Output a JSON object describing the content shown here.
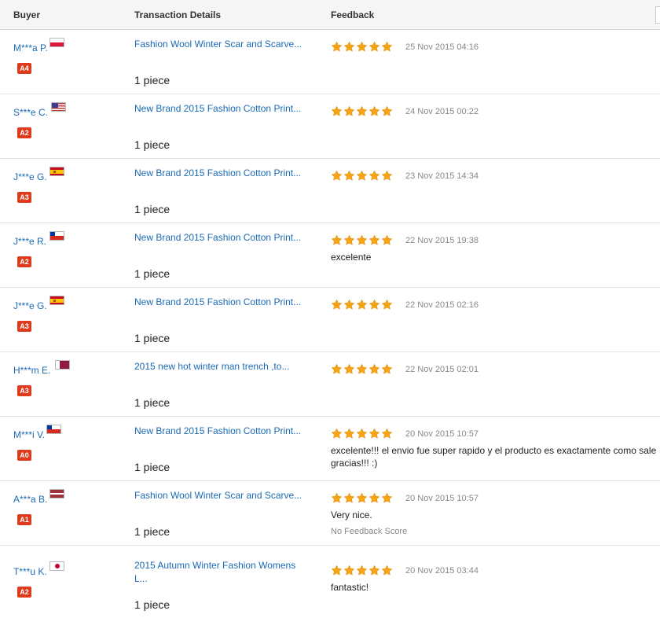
{
  "header": {
    "buyer": "Buyer",
    "transaction": "Transaction Details",
    "feedback": "Feedback"
  },
  "colors": {
    "link": "#1a6ab5",
    "badge": "#dd3b1c",
    "star": "#f7a418"
  },
  "rows": [
    {
      "buyer": "M***a P.",
      "flag": "poland",
      "level": "A4",
      "product": "Fashion Wool Winter Scar and Scarve...",
      "qty": "1 piece",
      "rating": 5,
      "date": "25 Nov 2015 04:16"
    },
    {
      "buyer": "S***e C.",
      "flag": "usa",
      "level": "A2",
      "product": "New Brand 2015 Fashion Cotton Print...",
      "qty": "1 piece",
      "rating": 5,
      "date": "24 Nov 2015 00:22"
    },
    {
      "buyer": "J***e G.",
      "flag": "spain",
      "level": "A3",
      "product": "New Brand 2015 Fashion Cotton Print...",
      "qty": "1 piece",
      "rating": 5,
      "date": "23 Nov 2015 14:34"
    },
    {
      "buyer": "J***e R.",
      "flag": "chile",
      "level": "A2",
      "product": "New Brand 2015 Fashion Cotton Print...",
      "qty": "1 piece",
      "rating": 5,
      "date": "22 Nov 2015 19:38",
      "comment": "excelente"
    },
    {
      "buyer": "J***e G.",
      "flag": "spain",
      "level": "A3",
      "product": "New Brand 2015 Fashion Cotton Print...",
      "qty": "1 piece",
      "rating": 5,
      "date": "22 Nov 2015 02:16"
    },
    {
      "buyer": "H***m E.",
      "flag": "qatar",
      "level": "A3",
      "product": "2015 new hot winter man trench ,to...",
      "qty": "1 piece",
      "rating": 5,
      "date": "22 Nov 2015 02:01"
    },
    {
      "buyer": "M***i V.",
      "flag": "chile",
      "level": "A0",
      "product": "New Brand 2015 Fashion Cotton Print...",
      "qty": "1 piece",
      "rating": 5,
      "date": "20 Nov 2015 10:57",
      "comment_line1": "excelente!!! el envio fue super rapido y el producto es exactamente como sale",
      "comment_line2": "gracias!!! :)"
    },
    {
      "buyer": "A***a B.",
      "flag": "latvia",
      "level": "A1",
      "product": "Fashion Wool Winter Scar and Scarve...",
      "qty": "1 piece",
      "rating": 5,
      "date": "20 Nov 2015 10:57",
      "comment": "Very nice.",
      "note": "No Feedback Score"
    },
    {
      "buyer": "T***u K.",
      "flag": "japan",
      "level": "A2",
      "product": "2015 Autumn Winter Fashion Womens L...",
      "qty": "1 piece",
      "rating": 5,
      "date": "20 Nov 2015 03:44",
      "comment": "fantastic!"
    }
  ]
}
